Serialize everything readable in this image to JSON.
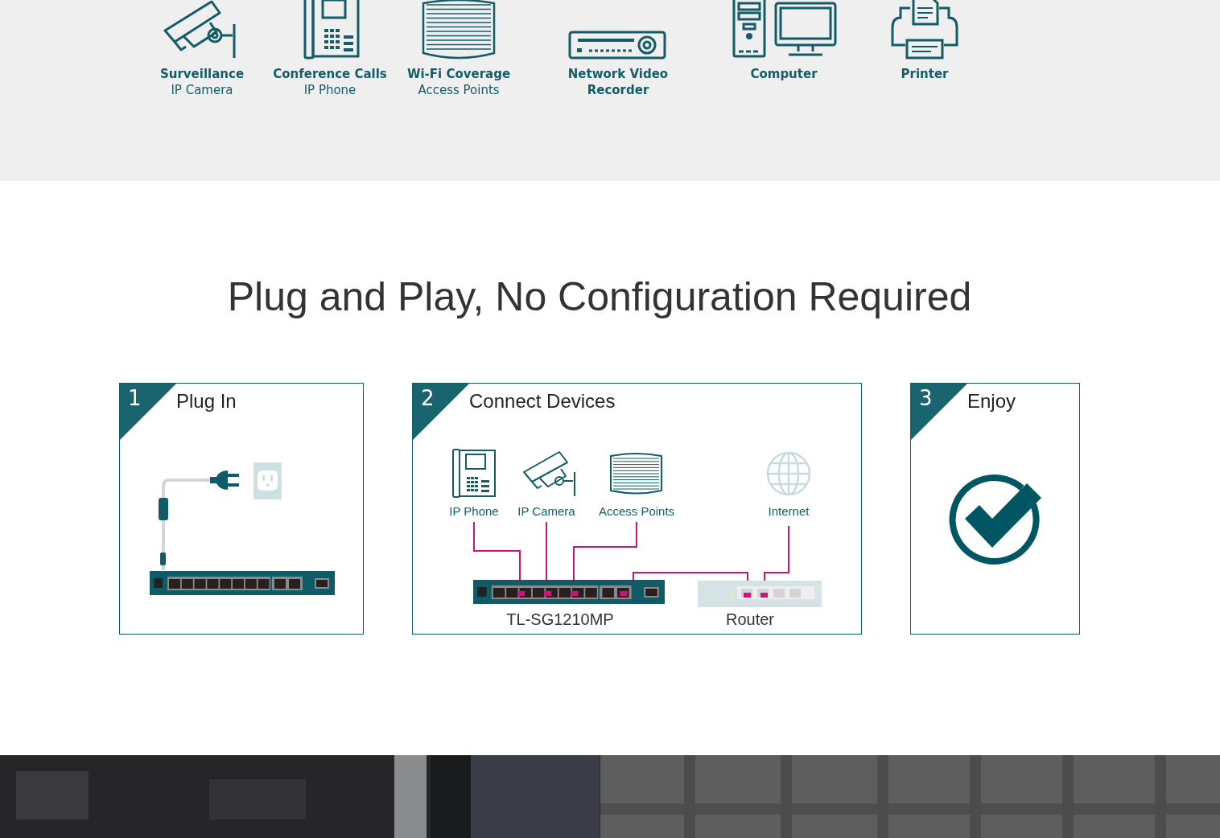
{
  "device_types": [
    {
      "kind": "camera",
      "title": "Surveillance",
      "subtitle": "IP Camera"
    },
    {
      "kind": "phone",
      "title": "Conference Calls",
      "subtitle": "IP Phone"
    },
    {
      "kind": "ap",
      "title": "Wi-Fi Coverage",
      "subtitle": "Access Points"
    },
    {
      "kind": "nvr",
      "title": "Network Video Recorder"
    },
    {
      "kind": "computer",
      "title": "Computer"
    },
    {
      "kind": "printer",
      "title": "Printer"
    }
  ],
  "heading": "Plug and Play, No Configuration Required",
  "steps": [
    {
      "number": "1",
      "title": "Plug In",
      "kind": "plug"
    },
    {
      "number": "2",
      "title": "Connect Devices",
      "kind": "connect",
      "devices": [
        "IP Phone",
        "IP Camera",
        "Access Points",
        "Internet"
      ],
      "switch_label": "TL-SG1210MP",
      "router_label": "Router"
    },
    {
      "number": "3",
      "title": "Enjoy",
      "kind": "enjoy"
    }
  ]
}
